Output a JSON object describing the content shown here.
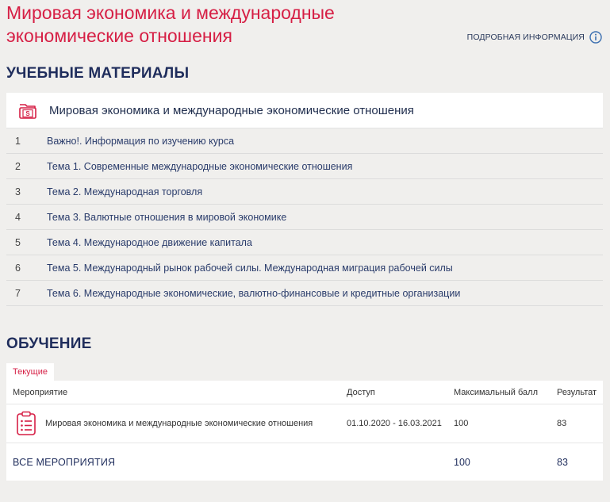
{
  "header": {
    "title": "Мировая экономика и международные экономические отношения",
    "info_link": "ПОДРОБНАЯ ИНФОРМАЦИЯ",
    "info_icon": "info-circle-icon"
  },
  "materials": {
    "heading": "УЧЕБНЫЕ МАТЕРИАЛЫ",
    "card_icon": "folder-s-icon",
    "card_title": "Мировая экономика и международные экономические отношения",
    "items": [
      {
        "num": "1",
        "label": "Важно!. Информация по изучению курса"
      },
      {
        "num": "2",
        "label": "Тема 1. Современные международные экономические отношения"
      },
      {
        "num": "3",
        "label": "Тема 2. Международная торговля"
      },
      {
        "num": "4",
        "label": "Тема 3. Валютные отношения в мировой экономике"
      },
      {
        "num": "5",
        "label": "Тема 4. Международное движение капитала"
      },
      {
        "num": "6",
        "label": "Тема 5. Международный рынок рабочей силы. Международная миграция рабочей силы"
      },
      {
        "num": "7",
        "label": "Тема 6. Международные экономические, валютно-финансовые и кредитные организации"
      }
    ]
  },
  "learning": {
    "heading": "ОБУЧЕНИЕ",
    "tab": "Текущие",
    "columns": {
      "event": "Мероприятие",
      "access": "Доступ",
      "max_score": "Максимальный балл",
      "result": "Результат"
    },
    "rows": [
      {
        "icon": "clipboard-list-icon",
        "event": "Мировая экономика и международные экономические отношения",
        "access": "01.10.2020 - 16.03.2021",
        "max_score": "100",
        "result": "83"
      }
    ],
    "total": {
      "label": "ВСЕ МЕРОПРИЯТИЯ",
      "max_score": "100",
      "result": "83"
    }
  },
  "colors": {
    "accent": "#d61f45",
    "navy": "#1f2d5c",
    "background": "#f0efed"
  }
}
